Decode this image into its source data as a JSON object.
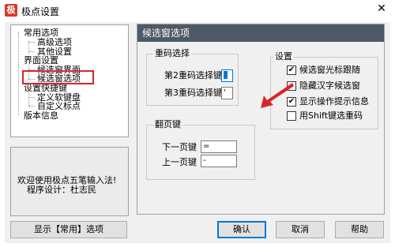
{
  "window": {
    "title": "极点设置",
    "icon": "app-logo-icon",
    "close_glyph": "✕"
  },
  "tree": {
    "items": [
      {
        "label": "常用选项"
      },
      {
        "label": "高级选项"
      },
      {
        "label": "其他设置"
      },
      {
        "label": "界面设置"
      },
      {
        "label": "候选窗界面"
      },
      {
        "label": "候选窗选项"
      },
      {
        "label": "设置快捷键"
      },
      {
        "label": "定义软键盘"
      },
      {
        "label": "自定义标点"
      },
      {
        "label": "版本信息"
      }
    ],
    "selected": "候选窗选项"
  },
  "info": {
    "line1": "欢迎使用极点五笔输入法!",
    "line2": "程序设计：杜志民"
  },
  "buttons": {
    "show_common": "显示【常用】选项",
    "ok": "确认",
    "cancel": "取消",
    "help": "帮助"
  },
  "panel": {
    "header": "候选窗选项",
    "dup_group": {
      "title": "重码选择",
      "key2_label": "第2重码选择键",
      "key2_value": ";",
      "key3_label": "第3重码选择键",
      "key3_value": "'"
    },
    "page_group": {
      "title": "翻页键",
      "next_label": "下一页键",
      "next_value": "=",
      "prev_label": "上一页键",
      "prev_value": "-"
    },
    "settings_group": {
      "title": "设置",
      "options": [
        {
          "label": "候选窗光标跟随",
          "checked": true
        },
        {
          "label": "隐藏汉字候选窗",
          "checked": false
        },
        {
          "label": "显示操作提示信息",
          "checked": true
        },
        {
          "label": "用Shift键选重码",
          "checked": false
        }
      ]
    }
  },
  "colors": {
    "header_bg": "#4d5965",
    "annotation_red": "#d9252a",
    "focus_blue": "#0078d7"
  }
}
